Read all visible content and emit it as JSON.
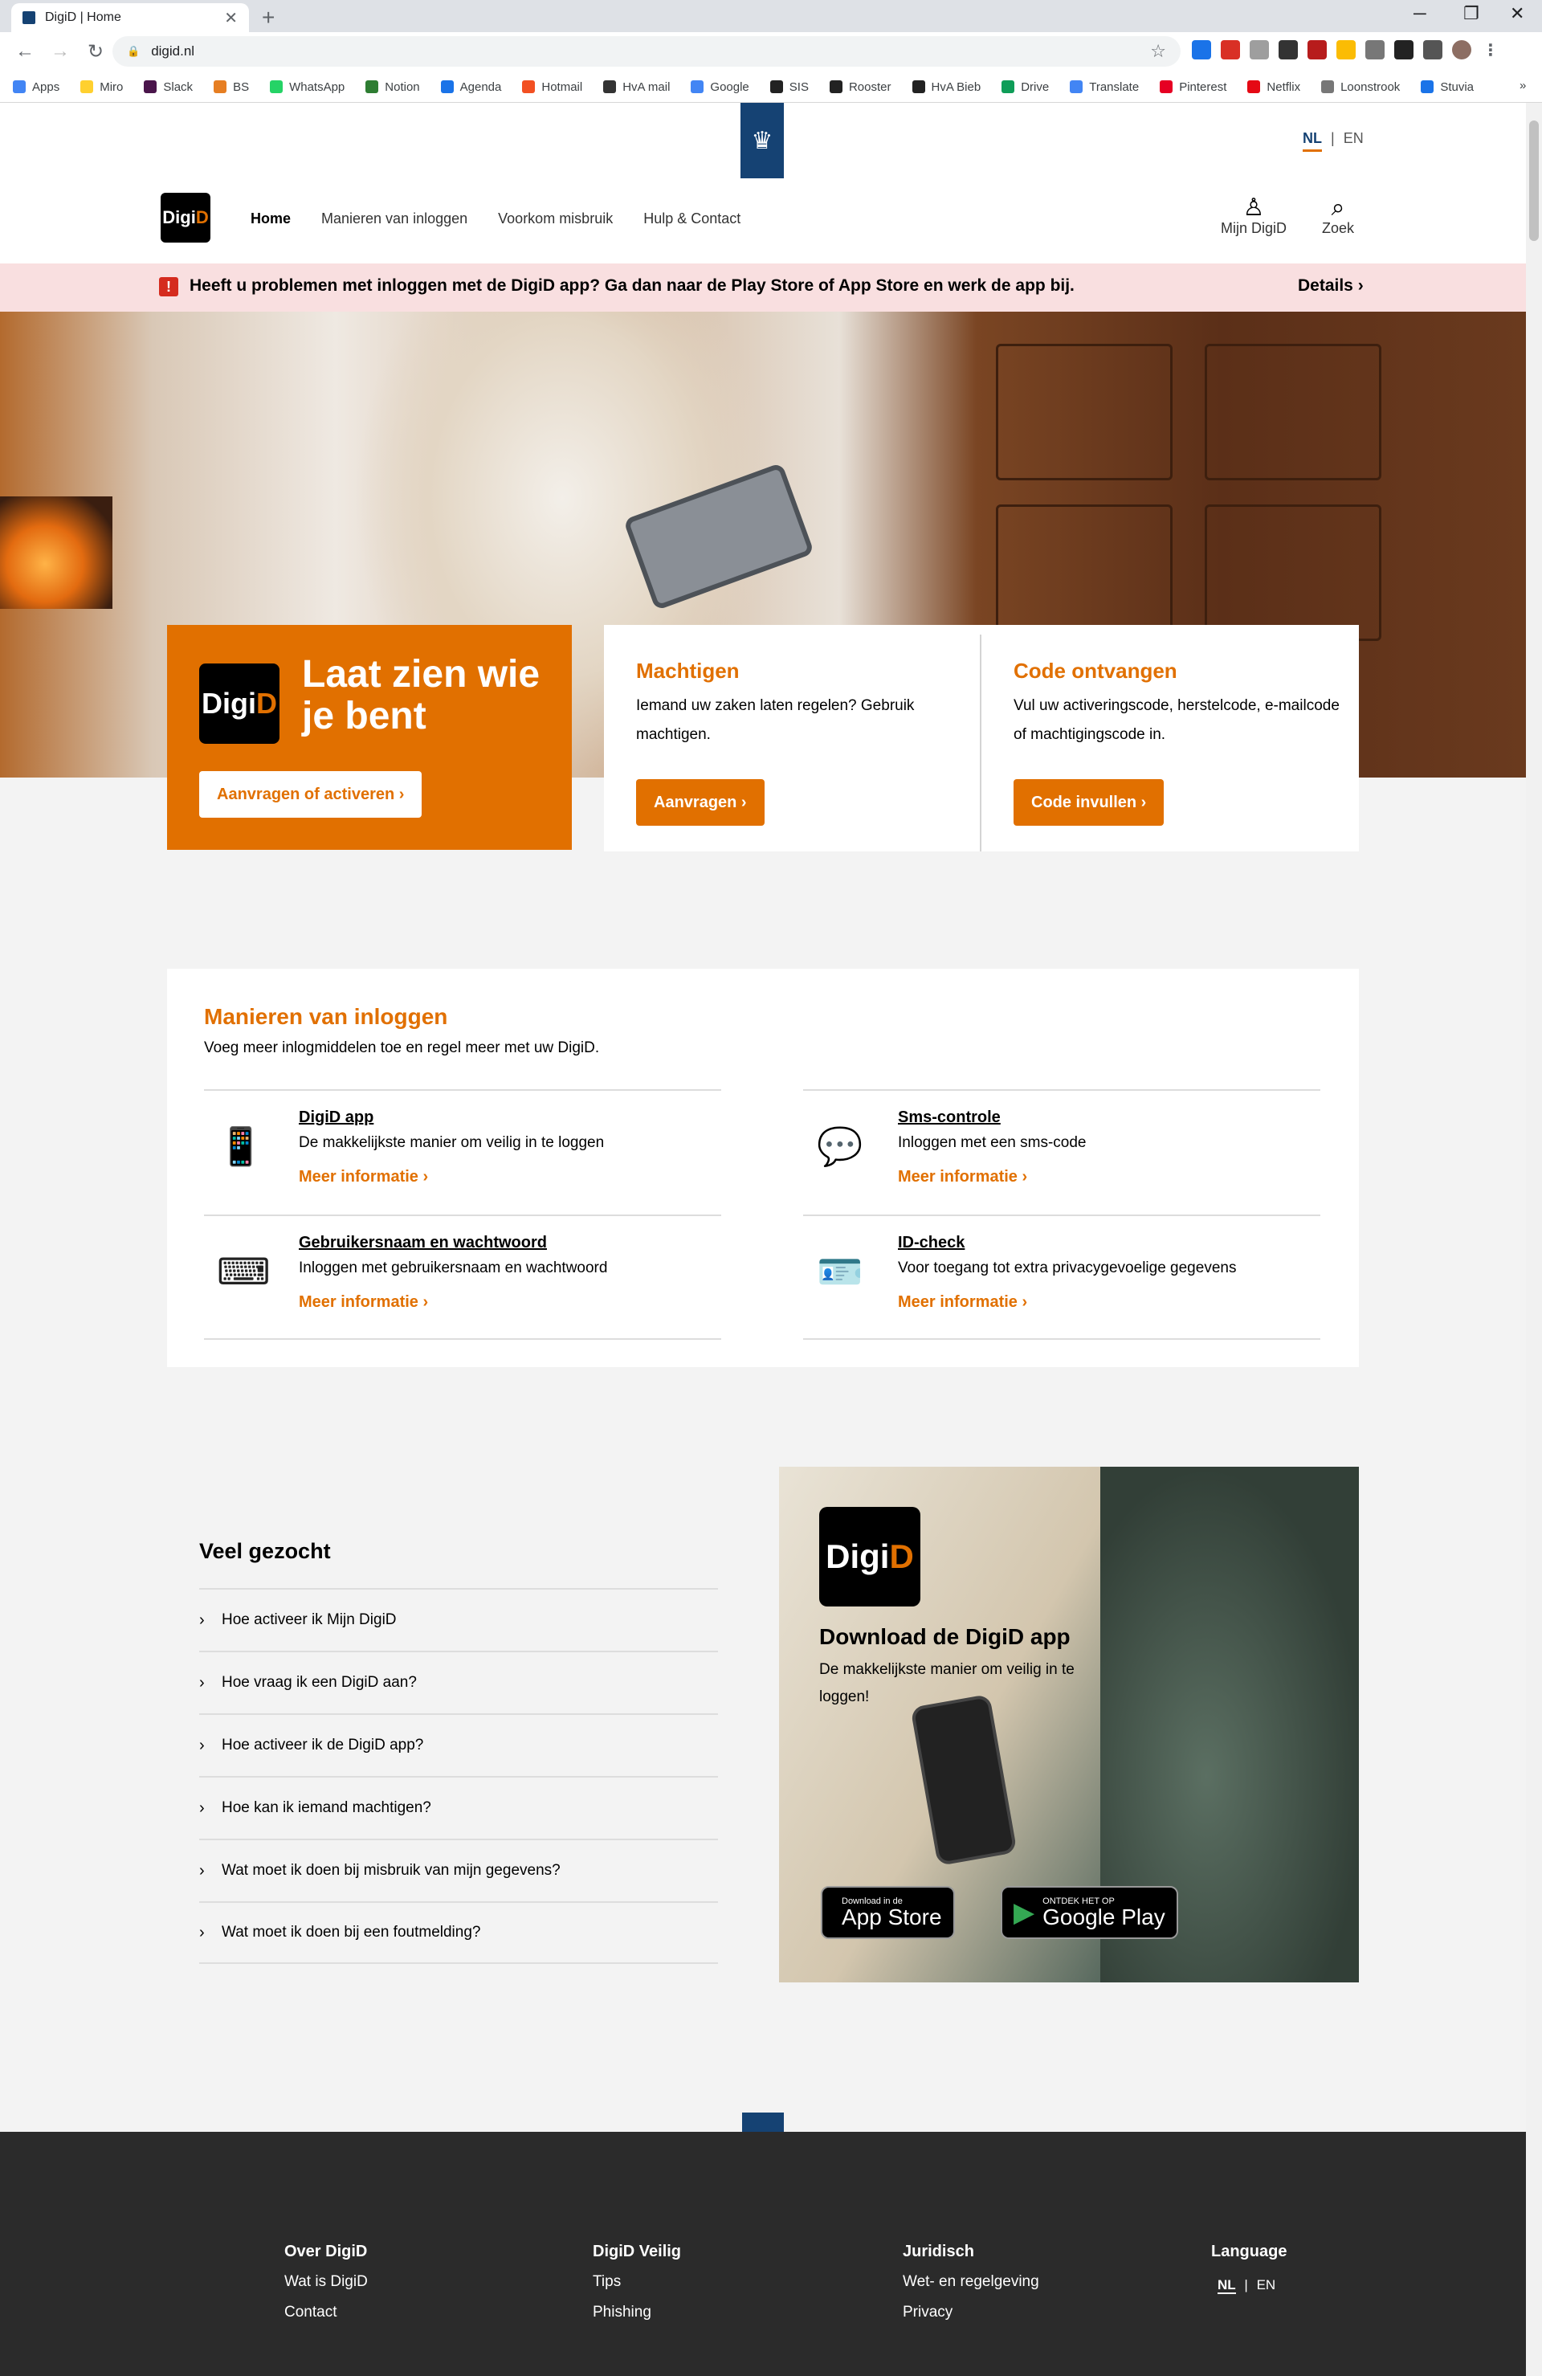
{
  "browser": {
    "tab_title": "DigiD | Home",
    "tab_close": "✕",
    "new_tab": "+",
    "url": "digid.nl",
    "window_controls": {
      "minimize": "─",
      "restore": "❐",
      "close": "✕"
    },
    "bookmarks": [
      {
        "label": "Apps",
        "color": "#4285f4"
      },
      {
        "label": "Miro",
        "color": "#ffd02f"
      },
      {
        "label": "Slack",
        "color": "#4a154b"
      },
      {
        "label": "BS",
        "color": "#e67e22"
      },
      {
        "label": "WhatsApp",
        "color": "#25d366"
      },
      {
        "label": "Notion",
        "color": "#2e7d32"
      },
      {
        "label": "Agenda",
        "color": "#1a73e8"
      },
      {
        "label": "Hotmail",
        "color": "#f25022"
      },
      {
        "label": "HvA mail",
        "color": "#333333"
      },
      {
        "label": "Google",
        "color": "#4285f4"
      },
      {
        "label": "SIS",
        "color": "#222222"
      },
      {
        "label": "Rooster",
        "color": "#222222"
      },
      {
        "label": "HvA Bieb",
        "color": "#222222"
      },
      {
        "label": "Drive",
        "color": "#0f9d58"
      },
      {
        "label": "Translate",
        "color": "#4285f4"
      },
      {
        "label": "Pinterest",
        "color": "#e60023"
      },
      {
        "label": "Netflix",
        "color": "#e50914"
      },
      {
        "label": "Loonstrook",
        "color": "#777777"
      },
      {
        "label": "Stuvia",
        "color": "#1a73e8"
      }
    ],
    "bookmarks_more": "»"
  },
  "header": {
    "lang_nl": "NL",
    "lang_sep": "|",
    "lang_en": "EN",
    "logo_digi": "Digi",
    "logo_d": "D",
    "nav": [
      "Home",
      "Manieren van inloggen",
      "Voorkom misbruik",
      "Hulp & Contact"
    ],
    "mijn_digid": "Mijn DigiD",
    "zoek": "Zoek"
  },
  "alert": {
    "icon": "!",
    "text": "Heeft u problemen met inloggen met de DigiD app? Ga dan naar de Play Store of App Store en werk de app bij.",
    "details": "Details ›"
  },
  "hero": {
    "headline": "Laat zien wie je bent",
    "primary_button": "Aanvragen of activeren  ›",
    "cards": [
      {
        "title": "Machtigen",
        "text": "Iemand uw zaken laten regelen? Gebruik machtigen.",
        "button": "Aanvragen  ›"
      },
      {
        "title": "Code ontvangen",
        "text": "Vul uw activeringscode, herstelcode, e-mailcode of machtigingscode in.",
        "button": "Code invullen  ›"
      }
    ]
  },
  "manieren": {
    "title": "Manieren van inloggen",
    "subtitle": "Voeg meer inlogmiddelen toe en regel meer met uw DigiD.",
    "more_label": "Meer informatie  ›",
    "items": [
      {
        "title": "DigiD app",
        "desc": "De makkelijkste manier om veilig in te loggen",
        "icon": "phone-tap-icon"
      },
      {
        "title": "Sms-controle",
        "desc": "Inloggen met een sms-code",
        "icon": "sms-phone-icon"
      },
      {
        "title": "Gebruikersnaam en wachtwoord",
        "desc": "Inloggen met gebruikersnaam en wachtwoord",
        "icon": "password-icon"
      },
      {
        "title": "ID-check",
        "desc": "Voor toegang tot extra privacygevoelige gegevens",
        "icon": "id-card-icon"
      }
    ]
  },
  "veel_gezocht": {
    "title": "Veel gezocht",
    "items": [
      "Hoe activeer ik Mijn DigiD",
      "Hoe vraag ik een DigiD aan?",
      "Hoe activeer ik de DigiD app?",
      "Hoe kan ik iemand machtigen?",
      "Wat moet ik doen bij misbruik van mijn gegevens?",
      "Wat moet ik doen bij een foutmelding?"
    ]
  },
  "promo": {
    "title": "Download de DigiD app",
    "text": "De makkelijkste manier om veilig in te loggen!",
    "appstore_small": "Download in de",
    "appstore_big": "App Store",
    "googleplay_small": "ONTDEK HET OP",
    "googleplay_big": "Google Play"
  },
  "footer": {
    "columns": [
      {
        "title": "Over DigiD",
        "links": [
          "Wat is DigiD",
          "Contact"
        ]
      },
      {
        "title": "DigiD Veilig",
        "links": [
          "Tips",
          "Phishing"
        ]
      },
      {
        "title": "Juridisch",
        "links": [
          "Wet- en regelgeving",
          "Privacy"
        ]
      }
    ],
    "language_title": "Language",
    "lang_nl": "NL",
    "lang_sep": "|",
    "lang_en": "EN"
  },
  "colors": {
    "accent": "#e17000",
    "brand": "#154273",
    "alert_bg": "#f9dfe0",
    "footer_bg": "#2b2b2b"
  }
}
